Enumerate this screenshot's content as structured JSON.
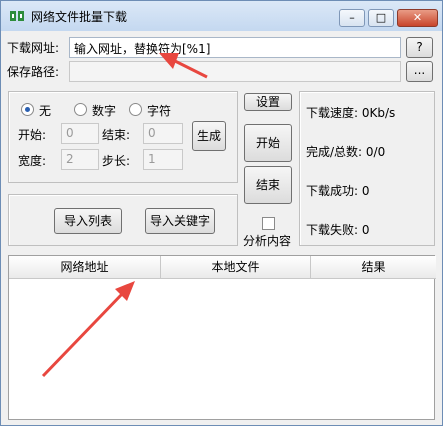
{
  "window": {
    "title": "网络文件批量下载",
    "minimize": "–",
    "maximize": "□",
    "close": "✕"
  },
  "url_row": {
    "label": "下载网址:",
    "value": "输入网址，替换符为[%1]",
    "help_button": "?"
  },
  "path_row": {
    "label": "保存路径:",
    "value": "",
    "browse_button": "..."
  },
  "mode": {
    "options": [
      "无",
      "数字",
      "字符"
    ],
    "selected": "无"
  },
  "range": {
    "start_label": "开始:",
    "start_value": "0",
    "end_label": "结束:",
    "end_value": "0",
    "width_label": "宽度:",
    "width_value": "2",
    "step_label": "步长:",
    "step_value": "1",
    "generate_button": "生成"
  },
  "import": {
    "list_button": "导入列表",
    "keyword_button": "导入关键字"
  },
  "controls": {
    "settings_button": "设置",
    "start_button": "开始",
    "stop_button": "结束",
    "analyze_label": "分析内容",
    "analyze_checked": false
  },
  "stats": {
    "speed": "下载速度: 0Kb/s",
    "done_total": "完成/总数: 0/0",
    "success": "下载成功: 0",
    "failed": "下载失败: 0"
  },
  "table": {
    "columns": [
      "网络地址",
      "本地文件",
      "结果"
    ],
    "rows": []
  },
  "colors": {
    "annotation_arrow": "#e8473f",
    "radio_selected": "#2a5fb0"
  }
}
